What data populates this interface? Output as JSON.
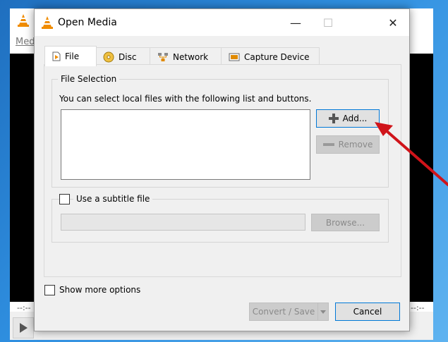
{
  "background": {
    "menu_label": "Med",
    "time_left": "--:--",
    "time_right": "--:--"
  },
  "dialog": {
    "title": "Open Media",
    "window_buttons": {
      "minimize": "—",
      "maximize": "☐",
      "close": "✕"
    }
  },
  "tabs": [
    {
      "label": "File",
      "icon": "file-icon"
    },
    {
      "label": "Disc",
      "icon": "disc-icon"
    },
    {
      "label": "Network",
      "icon": "network-icon"
    },
    {
      "label": "Capture Device",
      "icon": "capture-device-icon"
    }
  ],
  "file_selection": {
    "title": "File Selection",
    "description": "You can select local files with the following list and buttons.",
    "add_label": "Add...",
    "remove_label": "Remove"
  },
  "subtitle": {
    "checkbox_label": "Use a subtitle file",
    "browse_label": "Browse..."
  },
  "options": {
    "show_more_label": "Show more options"
  },
  "footer": {
    "convert_label": "Convert / Save",
    "cancel_label": "Cancel"
  },
  "colors": {
    "annotation_arrow": "#d0141a",
    "vlc_orange": "#f08c00"
  }
}
